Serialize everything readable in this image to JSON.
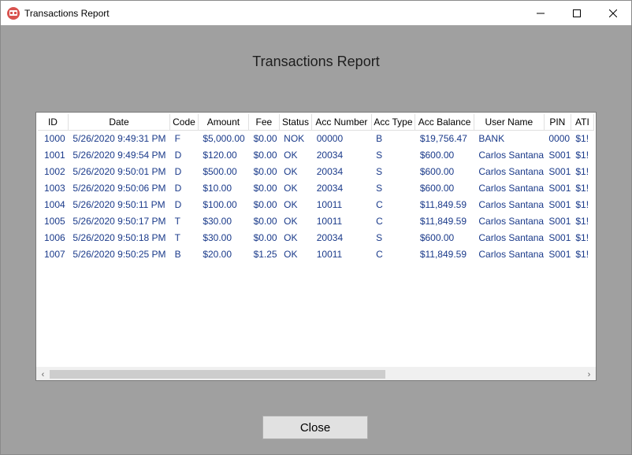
{
  "window": {
    "title": "Transactions Report",
    "icon": "app-logo-icon",
    "controls": [
      "minimize-icon",
      "maximize-icon",
      "close-icon"
    ]
  },
  "heading": "Transactions Report",
  "table": {
    "columns": [
      "ID",
      "Date",
      "Code",
      "Amount",
      "Fee",
      "Status",
      "Acc Number",
      "Acc Type",
      "Acc Balance",
      "User Name",
      "PIN",
      "ATI"
    ],
    "rows": [
      [
        "1000",
        "5/26/2020 9:49:31 PM",
        "F",
        "$5,000.00",
        "$0.00",
        "NOK",
        "00000",
        "B",
        "$19,756.47",
        "BANK",
        "0000",
        "$1!"
      ],
      [
        "1001",
        "5/26/2020 9:49:54 PM",
        "D",
        "$120.00",
        "$0.00",
        "OK",
        "20034",
        "S",
        "$600.00",
        "Carlos Santana",
        "S001",
        "$1!"
      ],
      [
        "1002",
        "5/26/2020 9:50:01 PM",
        "D",
        "$500.00",
        "$0.00",
        "OK",
        "20034",
        "S",
        "$600.00",
        "Carlos Santana",
        "S001",
        "$1!"
      ],
      [
        "1003",
        "5/26/2020 9:50:06 PM",
        "D",
        "$10.00",
        "$0.00",
        "OK",
        "20034",
        "S",
        "$600.00",
        "Carlos Santana",
        "S001",
        "$1!"
      ],
      [
        "1004",
        "5/26/2020 9:50:11 PM",
        "D",
        "$100.00",
        "$0.00",
        "OK",
        "10011",
        "C",
        "$11,849.59",
        "Carlos Santana",
        "S001",
        "$1!"
      ],
      [
        "1005",
        "5/26/2020 9:50:17 PM",
        "T",
        "$30.00",
        "$0.00",
        "OK",
        "10011",
        "C",
        "$11,849.59",
        "Carlos Santana",
        "S001",
        "$1!"
      ],
      [
        "1006",
        "5/26/2020 9:50:18 PM",
        "T",
        "$30.00",
        "$0.00",
        "OK",
        "20034",
        "S",
        "$600.00",
        "Carlos Santana",
        "S001",
        "$1!"
      ],
      [
        "1007",
        "5/26/2020 9:50:25 PM",
        "B",
        "$20.00",
        "$1.25",
        "OK",
        "10011",
        "C",
        "$11,849.59",
        "Carlos Santana",
        "S001",
        "$1!"
      ]
    ]
  },
  "buttons": {
    "close_label": "Close"
  },
  "colors": {
    "cell_text": "#1a3a8a",
    "background": "#a0a0a0",
    "app_icon": "#d9534f"
  }
}
